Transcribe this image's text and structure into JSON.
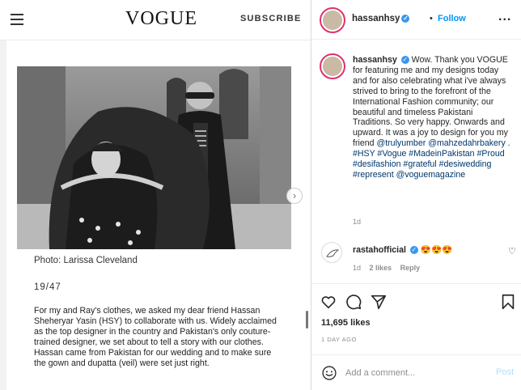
{
  "vogue": {
    "logo": "VOGUE",
    "subscribe": "SUBSCRIBE",
    "photo_credit": "Photo: Larissa Cleveland",
    "slide_counter": "19/47",
    "article_text": "For my and Ray's clothes, we asked my dear friend Hassan Sheheryar Yasin (HSY) to collaborate with us. Widely acclaimed as the top designer in the country and Pakistan's only couture-trained designer, we set about to tell a story with our clothes. Hassan came from Pakistan for our wedding and to make sure the gown and dupatta (veil) were set just right."
  },
  "post": {
    "username": "hassanhsy",
    "dot": "•",
    "follow": "Follow",
    "more": "...",
    "caption": {
      "username": "hassanhsy",
      "text": "Wow. Thank you VOGUE for featuring me and my designs today and for also celebrating what i've always strived to bring to the forefront of the International Fashion community; our beautiful and timeless Pakistani Traditions. So very happy. Onwards and upward. It was a joy to design for you my friend ",
      "mentions": "@trulyumber @mahzedahrbakery . #HSY #Vogue #MadeinPakistan #Proud #desifashion #grateful #desiwedding #represent @voguemagazine",
      "time": "1d"
    },
    "comment": {
      "username": "rastahofficial",
      "text": "😍😍😍",
      "time": "1d",
      "likes": "2 likes",
      "reply": "Reply"
    },
    "likes": "11,695 likes",
    "date": "1 DAY AGO",
    "add_comment_placeholder": "Add a comment...",
    "post_button": "Post"
  },
  "icons": [
    "hamburger-icon",
    "next-arrow-icon",
    "verified-icon",
    "heart-icon",
    "comment-icon",
    "share-icon",
    "bookmark-icon",
    "emoji-icon"
  ],
  "colors": {
    "link": "#00376b",
    "follow": "#0095f6",
    "verified": "#3897f0",
    "post_disabled": "#b2dffc"
  }
}
